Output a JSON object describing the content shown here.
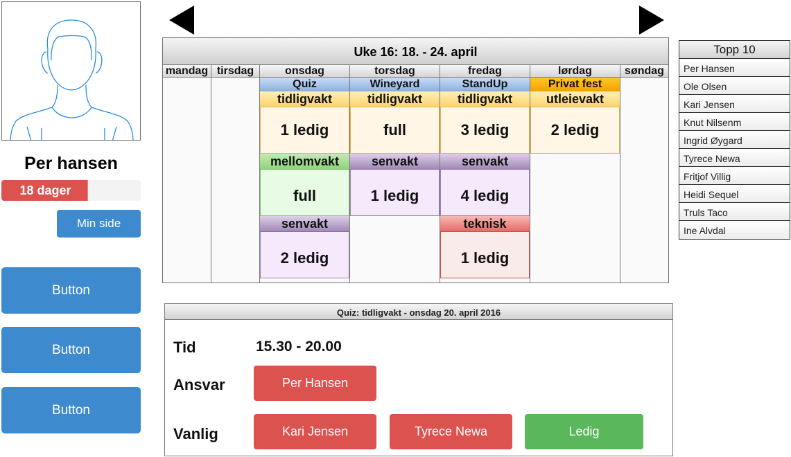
{
  "profile": {
    "name": "Per hansen",
    "progress_label": "18 dager",
    "progress_fraction": 0.62,
    "min_side_label": "Min side",
    "buttons": [
      "Button",
      "Button",
      "Button"
    ]
  },
  "nav": {
    "prev": "previous-week",
    "next": "next-week"
  },
  "calendar": {
    "title": "Uke 16: 18. - 24. april",
    "days": [
      "mandag",
      "tirsdag",
      "onsdag",
      "torsdag",
      "fredag",
      "lørdag",
      "søndag"
    ],
    "events": {
      "onsdag": {
        "event": "Quiz",
        "shifts": [
          {
            "name": "tidligvakt",
            "status": "1 ledig",
            "color": "yellow"
          },
          {
            "name": "mellomvakt",
            "status": "full",
            "color": "green"
          },
          {
            "name": "senvakt",
            "status": "2 ledig",
            "color": "purple"
          }
        ]
      },
      "torsdag": {
        "event": "Wineyard",
        "shifts": [
          {
            "name": "tidligvakt",
            "status": "full",
            "color": "yellow"
          },
          {
            "name": "senvakt",
            "status": "1 ledig",
            "color": "purple"
          }
        ]
      },
      "fredag": {
        "event": "StandUp",
        "shifts": [
          {
            "name": "tidligvakt",
            "status": "3 ledig",
            "color": "yellow"
          },
          {
            "name": "senvakt",
            "status": "4 ledig",
            "color": "purple"
          },
          {
            "name": "teknisk",
            "status": "1 ledig",
            "color": "red"
          }
        ]
      },
      "lordag": {
        "event": "Privat fest",
        "shifts": [
          {
            "name": "utleievakt",
            "status": "2 ledig",
            "color": "yellow"
          }
        ]
      }
    }
  },
  "top10": {
    "title": "Topp 10",
    "items": [
      "Per Hansen",
      "Ole Olsen",
      "Kari Jensen",
      "Knut Nilsenm",
      "Ingrid Øygard",
      "Tyrece Newa",
      "Fritjof Villig",
      "Heidi Sequel",
      "Truls Taco",
      "Ine Alvdal"
    ]
  },
  "detail": {
    "title": "Quiz: tidligvakt - onsdag 20. april 2016",
    "time_label": "Tid",
    "time_value": "15.30 - 20.00",
    "responsible_label": "Ansvar",
    "responsible": "Per Hansen",
    "regular_label": "Vanlig",
    "regular": [
      "Kari Jensen",
      "Tyrece Newa"
    ],
    "open_slot_label": "Ledig"
  },
  "colors": {
    "primary_blue": "#3e8ace",
    "danger_red": "#db524f",
    "success_green": "#5bb75b"
  }
}
